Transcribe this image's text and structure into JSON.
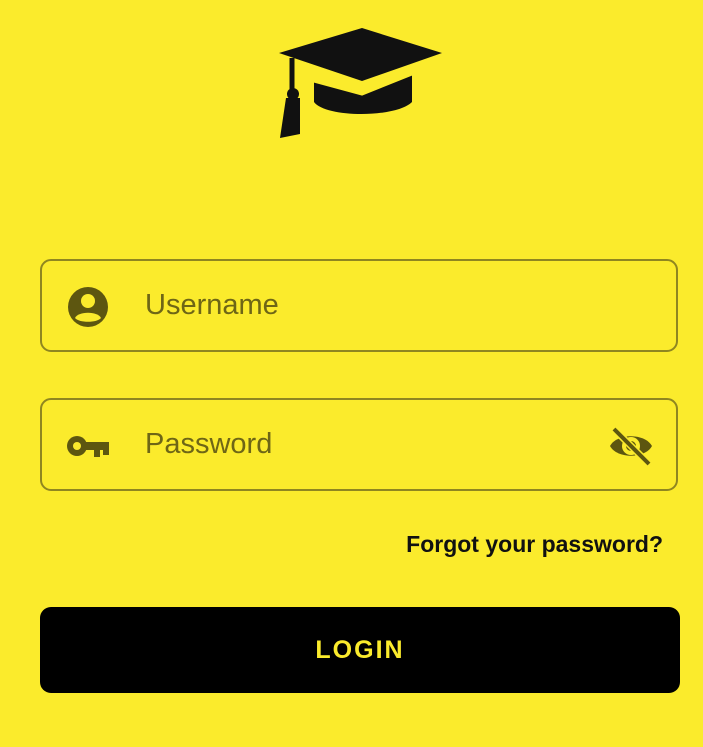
{
  "logo": {
    "icon": "graduation-cap-icon"
  },
  "username": {
    "icon": "account-circle-icon",
    "placeholder": "Username",
    "value": ""
  },
  "password": {
    "icon": "key-icon",
    "placeholder": "Password",
    "value": "",
    "toggle_icon": "eye-off-icon"
  },
  "forgot_password": {
    "label": "Forgot your password?"
  },
  "login_button": {
    "label": "LOGIN"
  },
  "colors": {
    "background": "#fbeb2c",
    "button": "#000000",
    "button_text": "#fbeb2c",
    "field_border": "#8f8620",
    "icon": "#5d5610"
  }
}
